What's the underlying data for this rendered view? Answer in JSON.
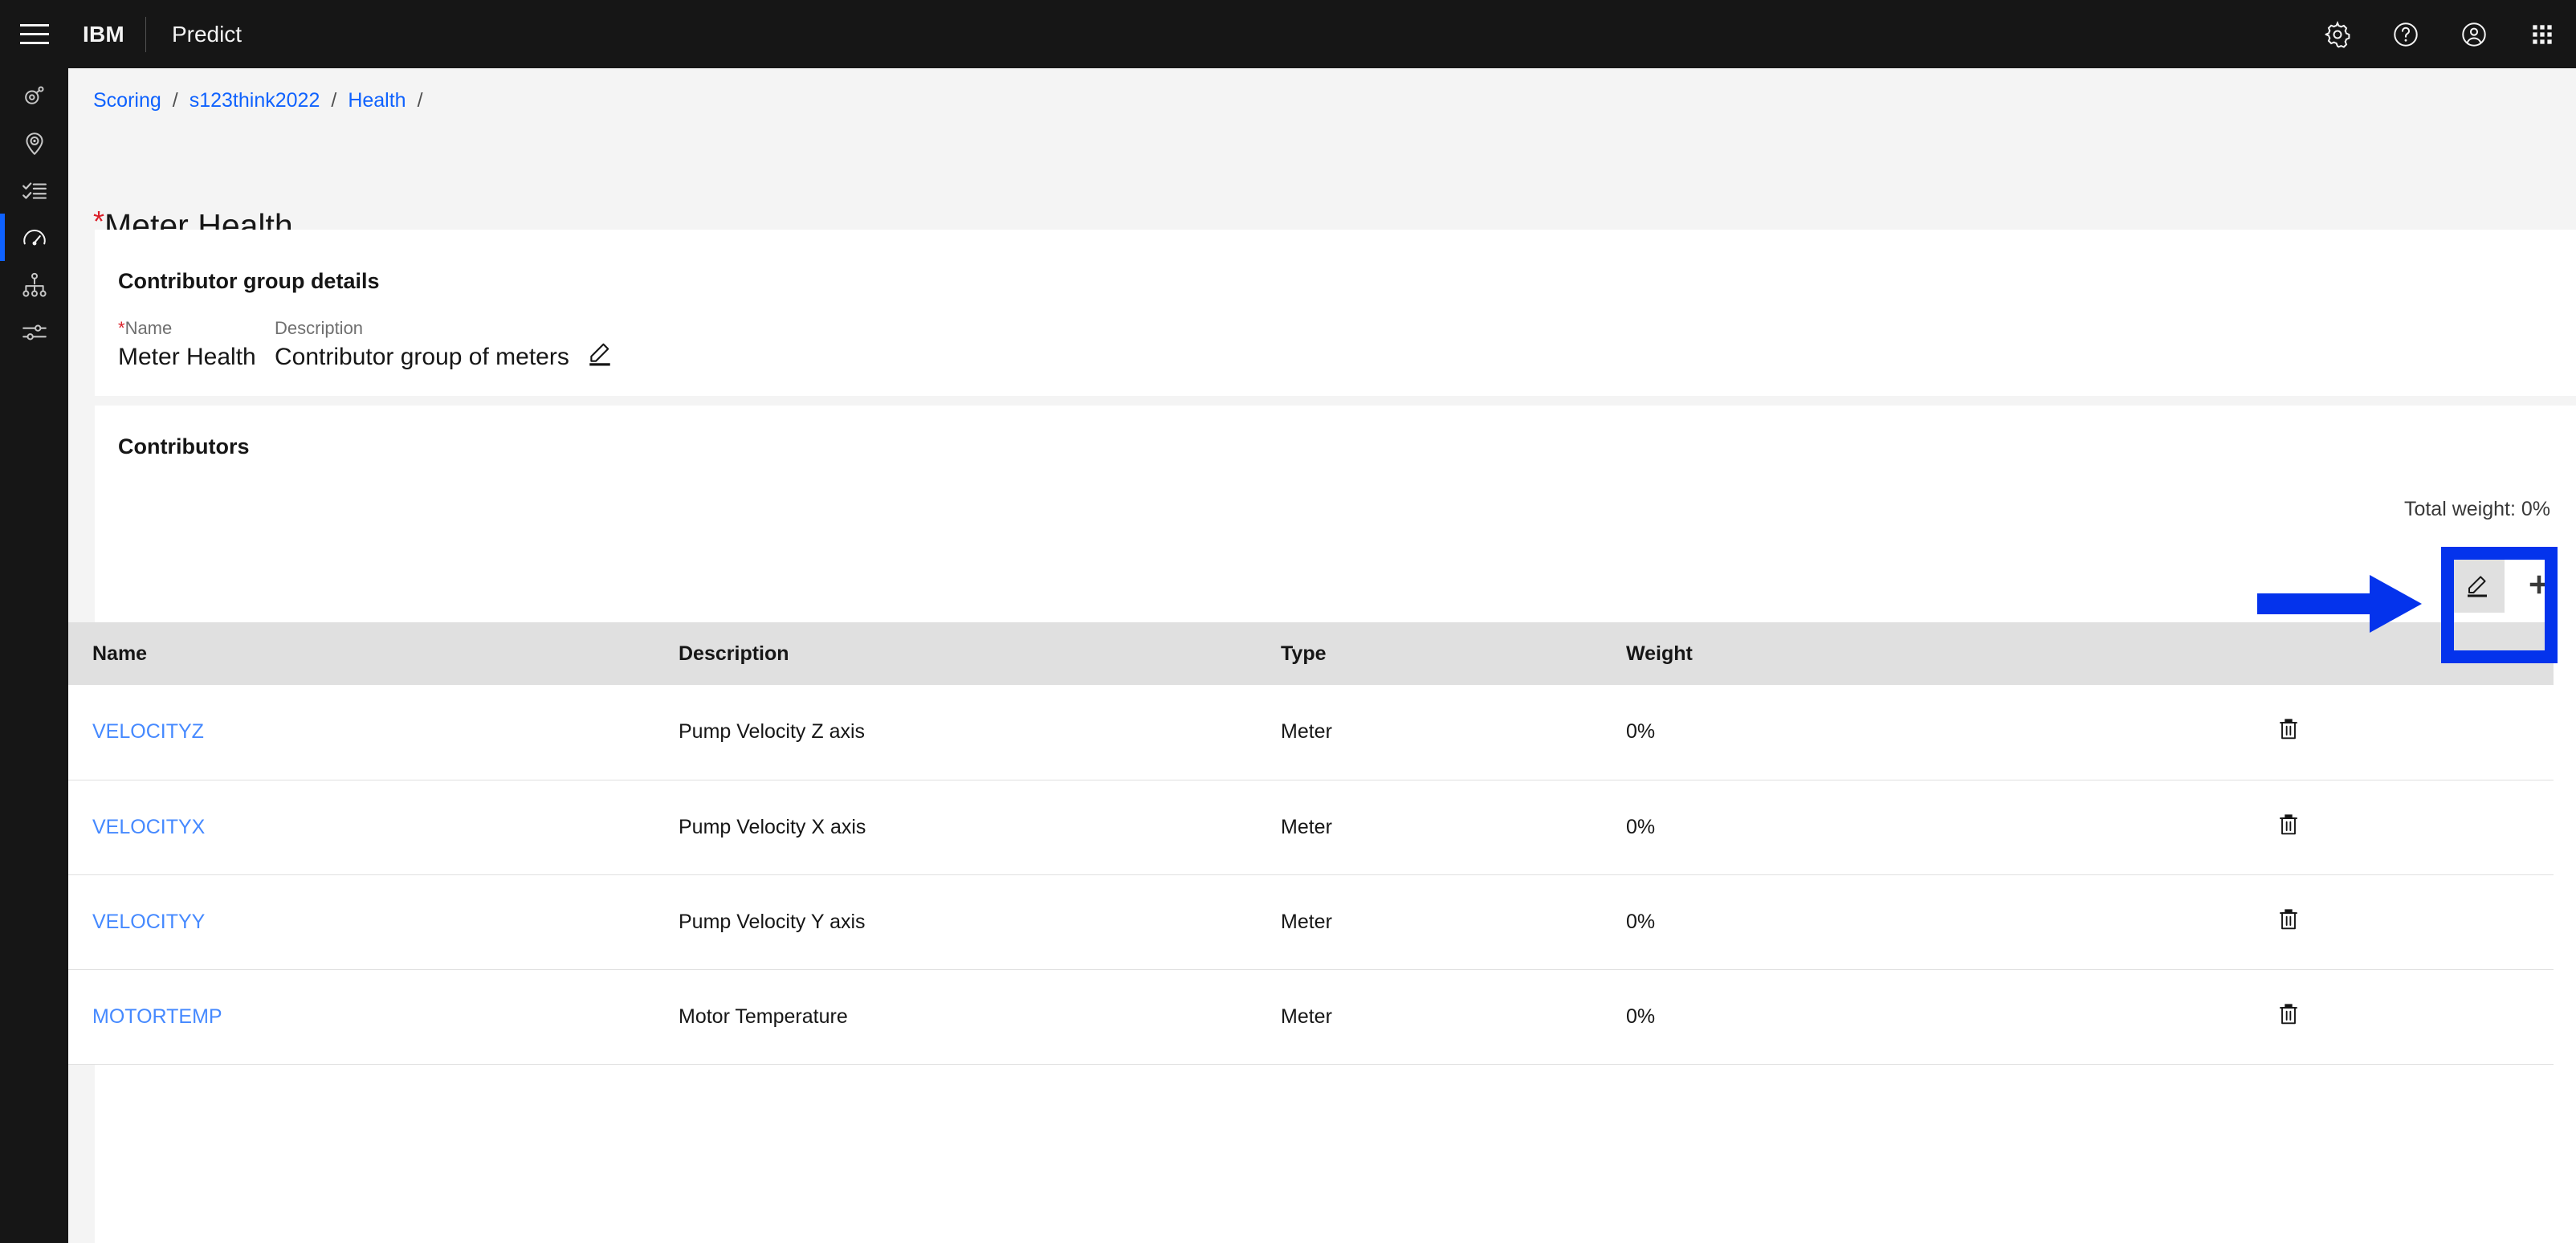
{
  "header": {
    "brand": "IBM",
    "app_name": "Predict",
    "menu_icon": "hamburger-menu-icon",
    "actions": [
      {
        "name": "settings-icon",
        "label": "Settings"
      },
      {
        "name": "help-icon",
        "label": "Help"
      },
      {
        "name": "user-avatar-icon",
        "label": "Account"
      },
      {
        "name": "app-switcher-icon",
        "label": "App switcher"
      }
    ]
  },
  "sidebar": {
    "items": [
      {
        "name": "asset-icon",
        "active": false
      },
      {
        "name": "location-pin-icon",
        "active": false
      },
      {
        "name": "task-list-icon",
        "active": false
      },
      {
        "name": "gauge-meter-icon",
        "active": true
      },
      {
        "name": "hierarchy-icon",
        "active": false
      },
      {
        "name": "settings-sliders-icon",
        "active": false
      }
    ]
  },
  "breadcrumb": {
    "items": [
      "Scoring",
      "s123think2022",
      "Health"
    ],
    "separator": "/",
    "trailing_separator": "/"
  },
  "page": {
    "required_marker": "*",
    "title": "Meter Health"
  },
  "details_card": {
    "heading": "Contributor group details",
    "name_label": "Name",
    "name_required_marker": "*",
    "name_value": "Meter Health",
    "description_label": "Description",
    "description_value": "Contributor group of meters",
    "edit_icon": "edit-pencil-icon"
  },
  "contributors_card": {
    "heading": "Contributors",
    "total_weight": "Total weight: 0%",
    "edit_button_icon": "edit-pencil-icon",
    "add_button_icon": "plus-icon",
    "columns": [
      "Name",
      "Description",
      "Type",
      "Weight"
    ],
    "rows": [
      {
        "name": "VELOCITYZ",
        "description": "Pump Velocity Z axis",
        "type": "Meter",
        "weight": "0%",
        "delete_icon": "trash-icon"
      },
      {
        "name": "VELOCITYX",
        "description": "Pump Velocity X axis",
        "type": "Meter",
        "weight": "0%",
        "delete_icon": "trash-icon"
      },
      {
        "name": "VELOCITYY",
        "description": "Pump Velocity Y axis",
        "type": "Meter",
        "weight": "0%",
        "delete_icon": "trash-icon"
      },
      {
        "name": "MOTORTEMP",
        "description": "Motor Temperature",
        "type": "Meter",
        "weight": "0%",
        "delete_icon": "trash-icon"
      }
    ]
  },
  "annotation": {
    "arrow_color": "#0433ec",
    "highlight_color": "#0433ec",
    "points_to": "contributors-edit-button"
  },
  "colors": {
    "header_bg": "#161616",
    "page_bg": "#f4f4f4",
    "card_bg": "#ffffff",
    "link": "#0f62fe",
    "table_link": "#4589ff",
    "table_header_bg": "#e0e0e0",
    "accent": "#0f62fe",
    "required": "#da1e28"
  }
}
